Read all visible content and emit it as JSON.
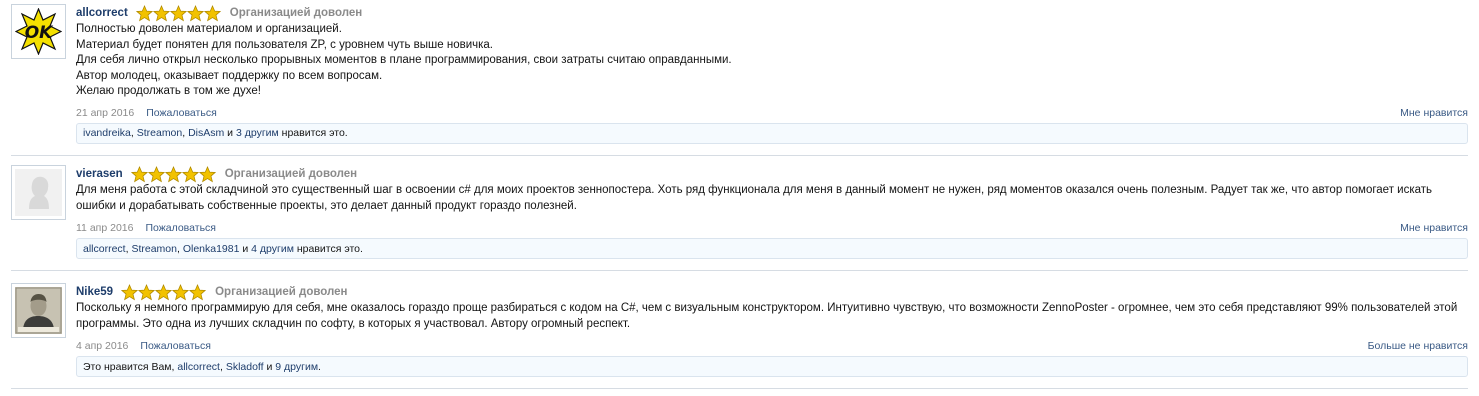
{
  "star_color": "#f2c200",
  "reviews": [
    {
      "username": "allcorrect",
      "rating": 5,
      "rating_label": "Организацией доволен",
      "avatar": "ok-logo-icon",
      "lines": [
        "Полностью доволен материалом и организацией.",
        "Материал будет понятен для пользователя ZP, с уровнем чуть выше новичка.",
        "Для себя лично открыл несколько прорывных моментов в плане программирования, свои затраты считаю оправданными.",
        "Автор молодец, оказывает поддержку по всем вопросам.",
        "Желаю продолжать в том же духе!"
      ],
      "date": "21 апр 2016",
      "report": "Пожаловаться",
      "like_action": "Мне нравится",
      "likes": {
        "users": [
          "ivandreika",
          "Streamon",
          "DisAsm"
        ],
        "and": " и ",
        "more": "3 другим",
        "suffix": " нравится это."
      }
    },
    {
      "username": "vierasen",
      "rating": 5,
      "rating_label": "Организацией доволен",
      "avatar": "default-avatar-icon",
      "text": "Для меня работа с этой складчиной это существенный шаг в освоении c# для моих проектов зеннопостера. Хоть ряд функционала для меня в данный момент не нужен, ряд моментов оказался очень полезным. Радует так же, что автор помогает искать ошибки и дорабатывать собственные проекты, это делает данный продукт гораздо полезней.",
      "date": "11 апр 2016",
      "report": "Пожаловаться",
      "like_action": "Мне нравится",
      "likes": {
        "users": [
          "allcorrect",
          "Streamon",
          "Olenka1981"
        ],
        "and": " и ",
        "more": "4 другим",
        "suffix": " нравится это."
      }
    },
    {
      "username": "Nike59",
      "rating": 5,
      "rating_label": "Организацией доволен",
      "avatar": "portrait-avatar-icon",
      "text": "Поскольку я немного программирую для себя, мне оказалось гораздо проще разбираться с кодом на C#, чем с визуальным конструктором. Интуитивно чувствую, что возможности ZennoPoster - огромнее, чем это себя представляют 99% пользователей этой программы. Это одна из лучших складчин по софту, в которых я участвовал. Автору огромный респект.",
      "date": "4 апр 2016",
      "report": "Пожаловаться",
      "like_action": "Больше не нравится",
      "likes": {
        "prefix": "Это нравится Вам, ",
        "users": [
          "allcorrect",
          "Skladoff"
        ],
        "and": " и ",
        "more": "9 другим",
        "suffix": "."
      }
    }
  ]
}
